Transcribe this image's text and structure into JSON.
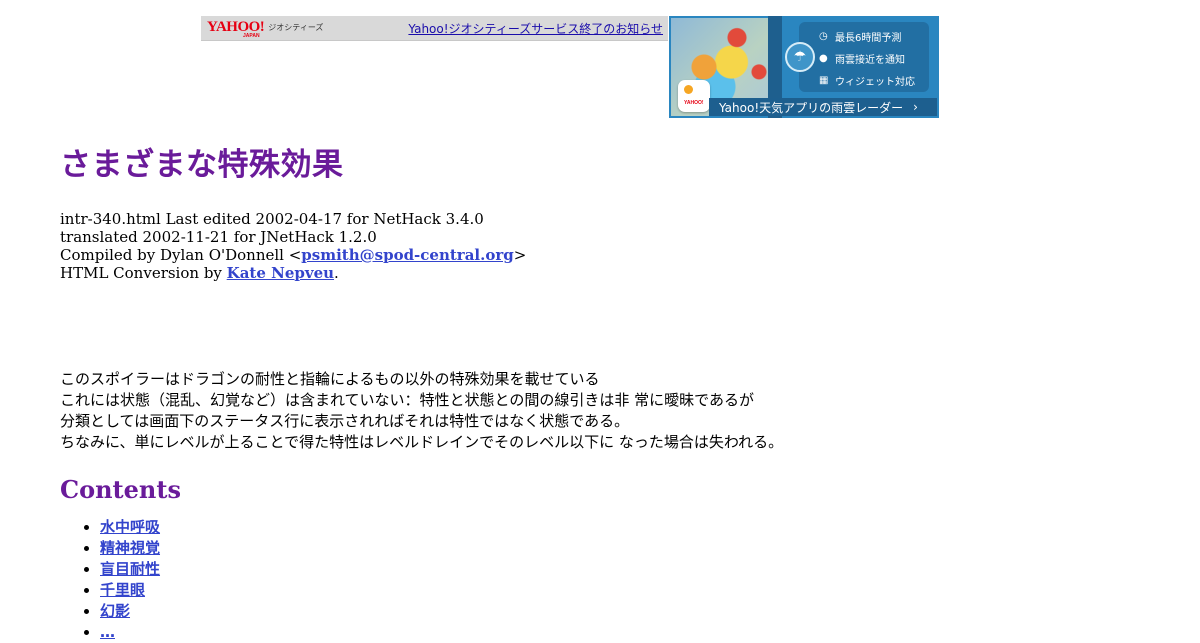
{
  "header": {
    "logo_word": "YAHOO!",
    "logo_japan": "JAPAN",
    "logo_service": "ジオシティーズ",
    "notice_link": "Yahoo!ジオシティーズサービス終了のお知らせ"
  },
  "ad": {
    "features": [
      {
        "icon": "clock-icon",
        "glyph": "◷",
        "label": "最長6時間予測"
      },
      {
        "icon": "pin-icon",
        "glyph": "●",
        "label": "雨雲接近を通知"
      },
      {
        "icon": "widget-icon",
        "glyph": "▦",
        "label": "ウィジェット対応"
      }
    ],
    "app_icon_text": "YAHOO!",
    "banner": "Yahoo!天気アプリの雨雲レーダー",
    "banner_chevron": "›"
  },
  "page": {
    "title": "さまざまな特殊効果",
    "meta": {
      "line1": "intr-340.html Last edited 2002-04-17 for NetHack 3.4.0",
      "line2": "translated 2002-11-21 for JNetHack 1.2.0",
      "compiled_prefix": "Compiled by Dylan O'Donnell <",
      "compiled_email": "psmith@spod-central.org",
      "compiled_suffix": ">",
      "html_prefix": "HTML Conversion by ",
      "html_author": "Kate Nepveu",
      "html_suffix": "."
    },
    "description": [
      "このスポイラーはドラゴンの耐性と指輪によるもの以外の特殊効果を載せている",
      "これには状態（混乱、幻覚など）は含まれていない：特性と状態との間の線引きは非 常に曖昧であるが",
      "分類としては画面下のステータス行に表示されればそれは特性ではなく状態である。",
      "ちなみに、単にレベルが上ることで得た特性はレベルドレインでそのレベル以下に なった場合は失われる。"
    ],
    "contents_heading": "Contents",
    "contents": [
      "水中呼吸",
      "精神視覚",
      "盲目耐性",
      "千里眼",
      "幻影",
      "…"
    ]
  },
  "colors": {
    "heading": "#6a1b9a",
    "link": "#3344cc",
    "yahoo_red": "#e60012",
    "ad_blue": "#2a86c0"
  }
}
